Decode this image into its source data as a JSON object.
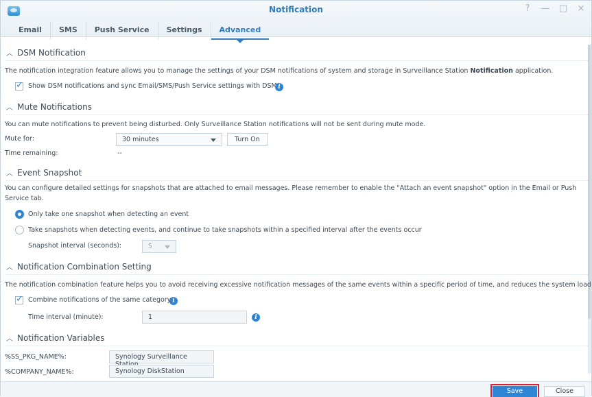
{
  "window": {
    "title": "Notification",
    "controls": [
      "?",
      "—",
      "□",
      "×"
    ]
  },
  "tabs": [
    {
      "label": "Email"
    },
    {
      "label": "SMS"
    },
    {
      "label": "Push Service"
    },
    {
      "label": "Settings"
    },
    {
      "label": "Advanced",
      "active": true
    }
  ],
  "dsm": {
    "title": "DSM Notification",
    "desc_pre": "The notification integration feature allows you to manage the settings of your DSM notifications of system and storage in Surveillance Station ",
    "desc_bold": "Notification",
    "desc_post": " application.",
    "check_label": "Show DSM notifications and sync Email/SMS/Push Service settings with DSM",
    "checked": true
  },
  "mute": {
    "title": "Mute Notifications",
    "desc": "You can mute notifications to prevent being disturbed. Only Surveillance Station notifications will not be sent during mute mode.",
    "mute_for_label": "Mute for:",
    "mute_for_value": "30 minutes",
    "turn_on_label": "Turn On",
    "time_remaining_label": "Time remaining:",
    "time_remaining_value": "--"
  },
  "snapshot": {
    "title": "Event Snapshot",
    "desc": "You can configure detailed settings for snapshots that are attached to email messages. Please remember to enable the \"Attach an event snapshot\" option in the Email or Push Service tab.",
    "radio1": "Only take one snapshot when detecting an event",
    "radio2": "Take snapshots when detecting events, and continue to take snapshots within a specified interval after the events occur",
    "interval_label": "Snapshot interval (seconds):",
    "interval_value": "5"
  },
  "combination": {
    "title": "Notification Combination Setting",
    "desc": "The notification combination feature helps you to avoid receiving excessive notification messages of the same events within a specific period of time, and reduces the system loading.",
    "check_label": "Combine notifications of the same category",
    "checked": true,
    "interval_label": "Time interval (minute):",
    "interval_value": "1"
  },
  "variables": {
    "title": "Notification Variables",
    "rows": [
      {
        "name": "%SS_PKG_NAME%:",
        "value": "Synology Surveillance Station"
      },
      {
        "name": "%COMPANY_NAME%:",
        "value": "Synology DiskStation"
      }
    ]
  },
  "footer": {
    "save_label": "Save",
    "close_label": "Close"
  },
  "colors": {
    "accent": "#2f84d4",
    "highlight": "#d6233a"
  }
}
